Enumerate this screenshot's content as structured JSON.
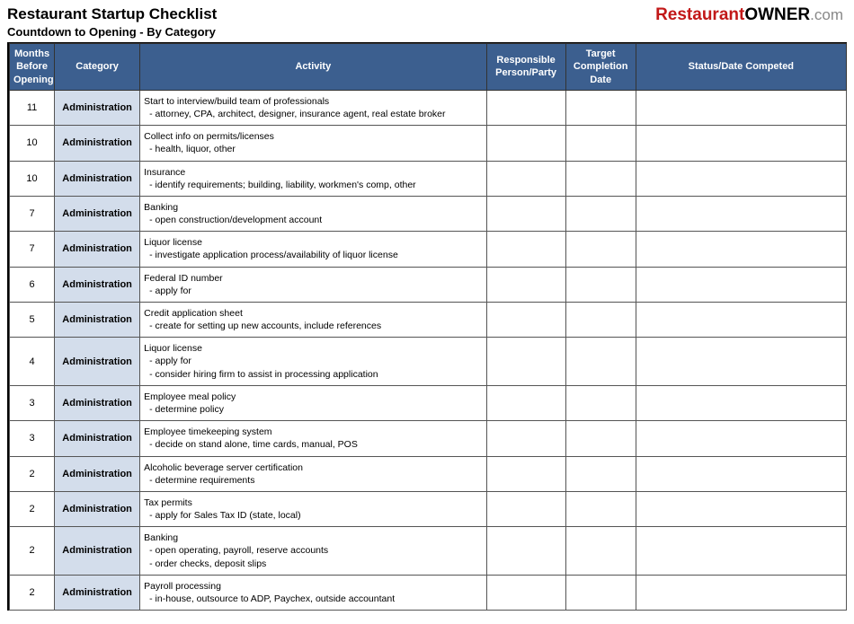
{
  "header": {
    "title": "Restaurant Startup Checklist",
    "subtitle": "Countdown to Opening  - By Category",
    "logo_parts": {
      "a": "Restaurant",
      "b": "OWNER",
      "c": ".com"
    }
  },
  "columns": {
    "months": "Months Before Opening",
    "category": "Category",
    "activity": "Activity",
    "responsible": "Responsible Person/Party",
    "target": "Target Completion Date",
    "status": "Status/Date Competed"
  },
  "rows": [
    {
      "months": "11",
      "category": "Administration",
      "title": "Start to interview/build team of professionals",
      "subs": [
        "  - attorney, CPA, architect, designer, insurance agent, real estate broker"
      ]
    },
    {
      "months": "10",
      "category": "Administration",
      "title": "Collect info on permits/licenses",
      "subs": [
        "  - health, liquor, other"
      ]
    },
    {
      "months": "10",
      "category": "Administration",
      "title": "Insurance",
      "subs": [
        "  - identify requirements; building, liability, workmen's comp, other"
      ]
    },
    {
      "months": "7",
      "category": "Administration",
      "title": "Banking",
      "subs": [
        "  - open construction/development account"
      ]
    },
    {
      "months": "7",
      "category": "Administration",
      "title": "Liquor license",
      "subs": [
        "  - investigate application process/availability of liquor license"
      ]
    },
    {
      "months": "6",
      "category": "Administration",
      "title": "Federal ID number",
      "subs": [
        "  - apply for"
      ]
    },
    {
      "months": "5",
      "category": "Administration",
      "title": "Credit application sheet",
      "subs": [
        "  - create for setting up new accounts, include references"
      ]
    },
    {
      "months": "4",
      "category": "Administration",
      "title": "Liquor license",
      "subs": [
        "  - apply for",
        "  - consider hiring firm to assist in processing application"
      ]
    },
    {
      "months": "3",
      "category": "Administration",
      "title": "Employee meal policy",
      "subs": [
        "  - determine policy"
      ]
    },
    {
      "months": "3",
      "category": "Administration",
      "title": "Employee timekeeping system",
      "subs": [
        "  - decide on stand alone, time cards, manual, POS"
      ]
    },
    {
      "months": "2",
      "category": "Administration",
      "title": "Alcoholic beverage server certification",
      "subs": [
        "  - determine requirements"
      ]
    },
    {
      "months": "2",
      "category": "Administration",
      "title": "Tax permits",
      "subs": [
        "  - apply for Sales Tax ID (state, local)"
      ]
    },
    {
      "months": "2",
      "category": "Administration",
      "title": "Banking",
      "subs": [
        "  - open operating, payroll, reserve accounts",
        "  - order checks, deposit slips"
      ]
    },
    {
      "months": "2",
      "category": "Administration",
      "title": "Payroll processing",
      "subs": [
        "  - in-house, outsource to ADP, Paychex, outside accountant"
      ]
    }
  ]
}
